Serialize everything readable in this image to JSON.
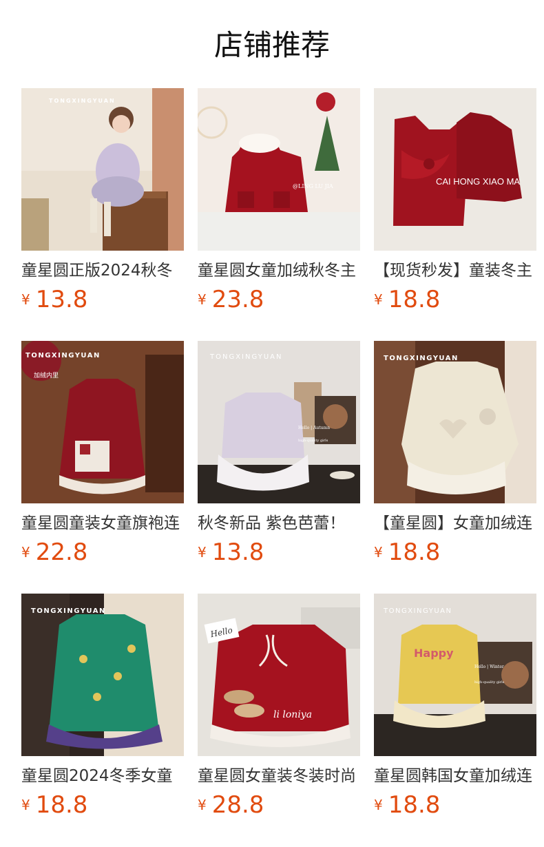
{
  "section": {
    "title": "店铺推荐"
  },
  "currency_symbol": "¥",
  "price_color": "#e14b0f",
  "products": [
    {
      "name": "童星圆正版2024秋冬",
      "price": "13.8",
      "image_text": [
        "TONGXINGYUAN"
      ]
    },
    {
      "name": "童星圆女童加绒秋冬主",
      "price": "23.8",
      "image_text": [
        "@LING LU JIA"
      ]
    },
    {
      "name": "【现货秒发】童装冬主",
      "price": "18.8",
      "image_text": [
        "CAI HONG XIAO MA"
      ]
    },
    {
      "name": "童星圆童装女童旗袍连",
      "price": "22.8",
      "image_text": [
        "TONGXINGYUAN",
        "加绒内里"
      ]
    },
    {
      "name": "秋冬新品 紫色芭蕾！",
      "price": "13.8",
      "image_text": [
        "TONGXINGYUAN",
        "Hello | Autumn",
        "high-quality girls"
      ]
    },
    {
      "name": "【童星圆】女童加绒连",
      "price": "18.8",
      "image_text": [
        "TONGXINGYUAN"
      ]
    },
    {
      "name": "童星圆2024冬季女童",
      "price": "18.8",
      "image_text": [
        "TONGXINGYUAN"
      ]
    },
    {
      "name": "童星圆女童装冬装时尚",
      "price": "28.8",
      "image_text": [
        "Hello",
        "li loniya"
      ]
    },
    {
      "name": "童星圆韩国女童加绒连",
      "price": "18.8",
      "image_text": [
        "TONGXINGYUAN",
        "Happy",
        "Hello | Winter",
        "high-quality girls"
      ]
    }
  ]
}
